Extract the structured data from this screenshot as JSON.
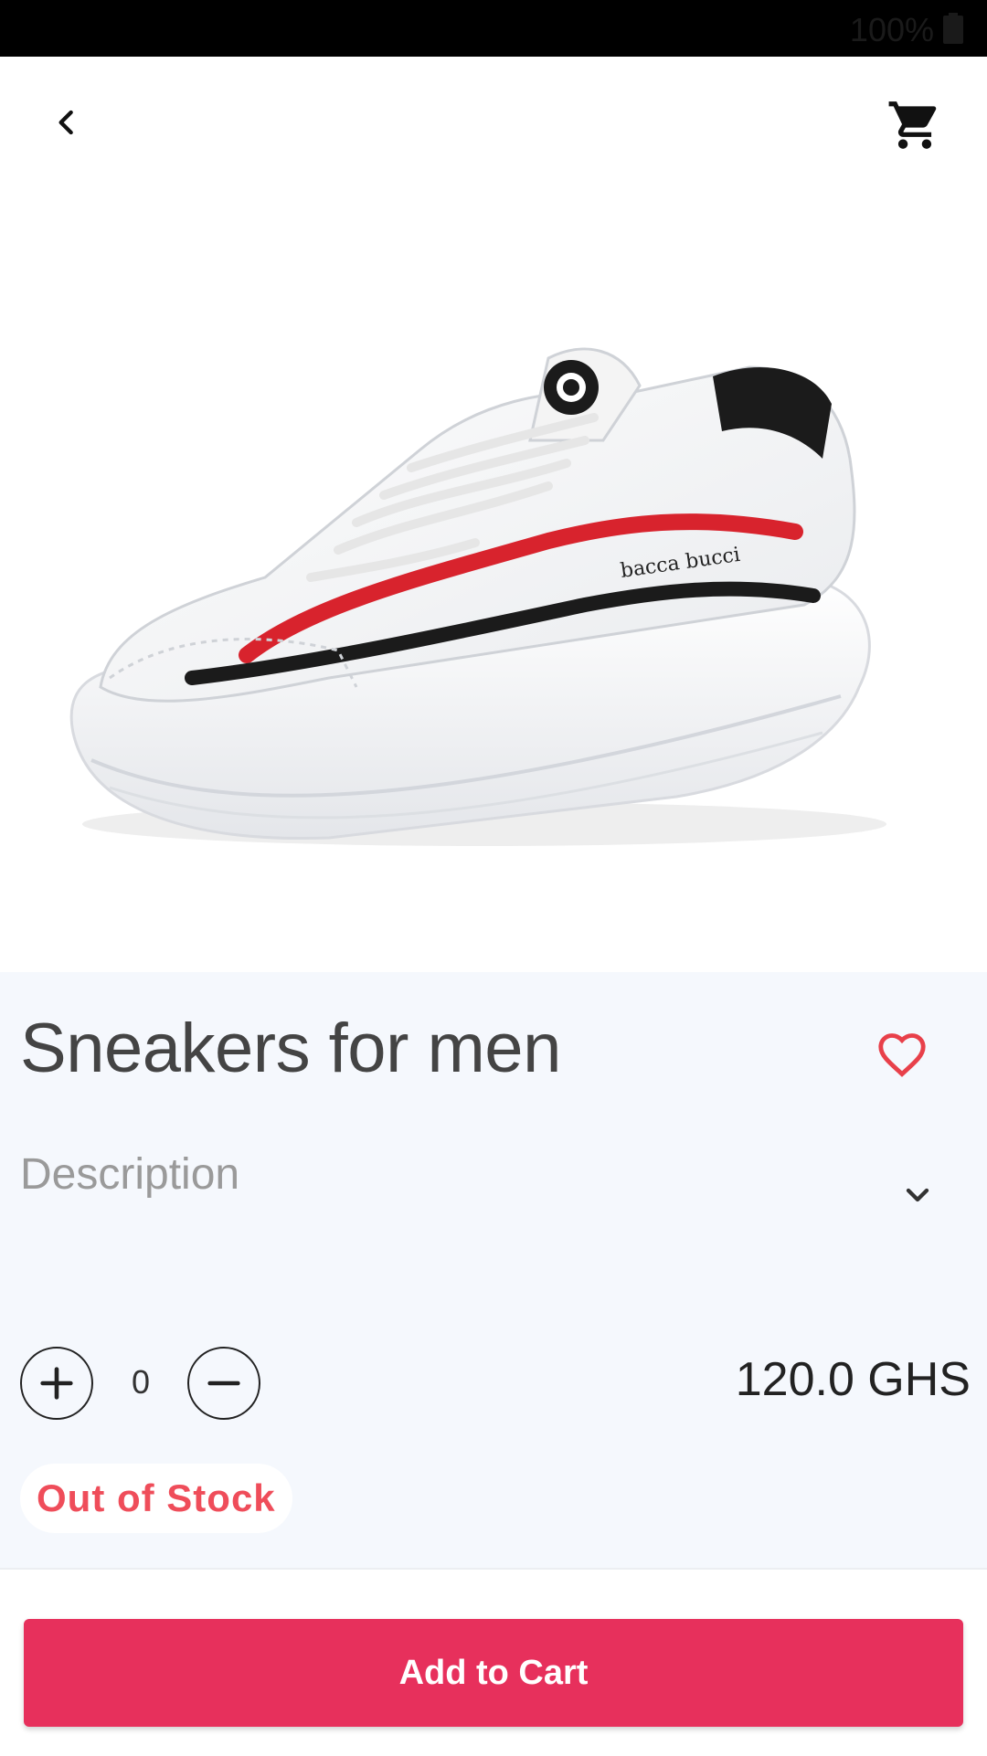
{
  "status_bar": {
    "battery": "100%"
  },
  "app_bar": {
    "back_icon": "chevron-left-icon",
    "cart_icon": "shopping-cart-icon"
  },
  "product": {
    "title": "Sneakers for men",
    "brand_print": "bacca bucci",
    "favorite_icon": "heart-outline-icon",
    "description_label": "Description",
    "quantity": "0",
    "price": "120.0 GHS",
    "stock_status": "Out of Stock"
  },
  "actions": {
    "add_to_cart": "Add to Cart"
  },
  "colors": {
    "accent": "#e7305c",
    "stock_red": "#ef4d5a",
    "panel_bg": "#f5f8fd"
  }
}
